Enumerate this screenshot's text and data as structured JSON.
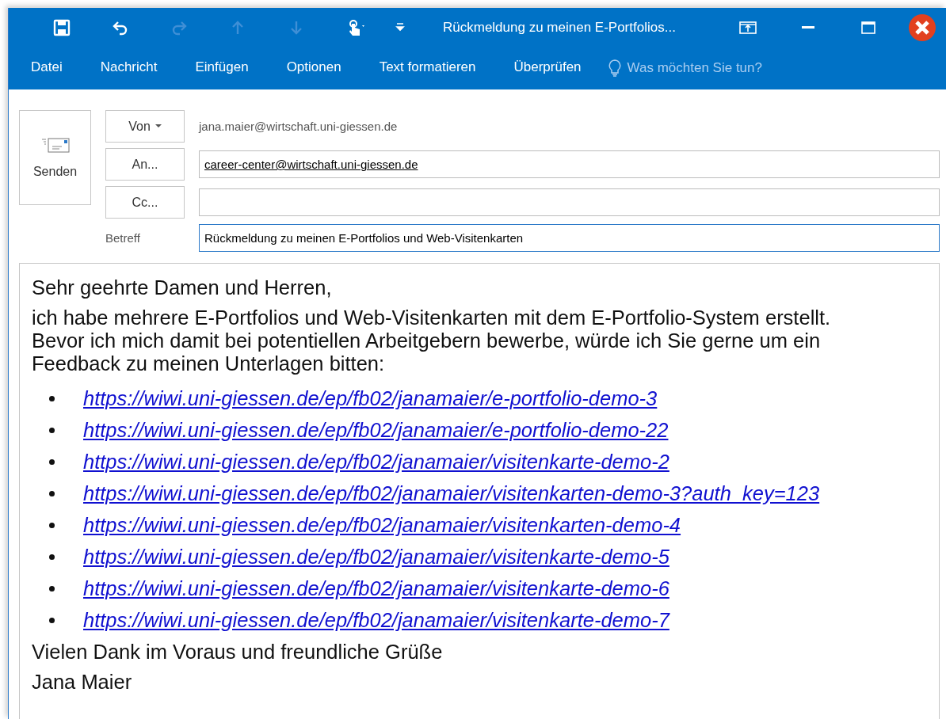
{
  "quick_access": [
    {
      "kind": "save",
      "disabled": false
    },
    {
      "kind": "undo",
      "disabled": false
    },
    {
      "kind": "redo",
      "disabled": true
    },
    {
      "kind": "up",
      "disabled": true
    },
    {
      "kind": "down",
      "disabled": true
    },
    {
      "kind": "touch",
      "disabled": false
    },
    {
      "kind": "customize",
      "disabled": false
    }
  ],
  "window": {
    "title": "Rückmeldung zu meinen E-Portfolios..."
  },
  "ribbon_tabs": [
    {
      "label": "Datei",
      "selected": false
    },
    {
      "label": "Nachricht",
      "selected": false
    },
    {
      "label": "Einfügen",
      "selected": false
    },
    {
      "label": "Optionen",
      "selected": false
    },
    {
      "label": "Text formatieren",
      "selected": false
    },
    {
      "label": "Überprüfen",
      "selected": false
    }
  ],
  "tell_me": {
    "placeholder": "Was möchten Sie tun?"
  },
  "send_button": {
    "label": "Senden"
  },
  "from": {
    "button": "Von",
    "value": "jana.maier@wirtschaft.uni-giessen.de"
  },
  "to": {
    "button": "An...",
    "value": "career-center@wirtschaft.uni-giessen.de"
  },
  "cc": {
    "button": "Cc..."
  },
  "subject": {
    "label": "Betreff",
    "value": "Rückmeldung zu meinen E-Portfolios und Web-Visitenkarten",
    "focused": true
  },
  "body": {
    "greeting": "Sehr geehrte Damen und Herren,",
    "paragraph": "ich habe mehrere E-Portfolios und Web-Visitenkarten mit dem E-Portfolio-System erstellt. Bevor ich mich damit bei potentiellen Arbeitgebern bewerbe, würde ich Sie gerne um ein Feedback zu meinen Unterlagen bitten:",
    "links": [
      "https://wiwi.uni-giessen.de/ep/fb02/janamaier/e-portfolio-demo-3",
      "https://wiwi.uni-giessen.de/ep/fb02/janamaier/e-portfolio-demo-22",
      "https://wiwi.uni-giessen.de/ep/fb02/janamaier/visitenkarte-demo-2",
      "https://wiwi.uni-giessen.de/ep/fb02/janamaier/visitenkarten-demo-3?auth_key=123",
      "https://wiwi.uni-giessen.de/ep/fb02/janamaier/visitenkarten-demo-4",
      "https://wiwi.uni-giessen.de/ep/fb02/janamaier/visitenkarte-demo-5",
      "https://wiwi.uni-giessen.de/ep/fb02/janamaier/visitenkarte-demo-6",
      "https://wiwi.uni-giessen.de/ep/fb02/janamaier/visitenkarte-demo-7"
    ],
    "closing": "Vielen Dank im Voraus und freundliche Grüße",
    "signature": "Jana Maier"
  }
}
